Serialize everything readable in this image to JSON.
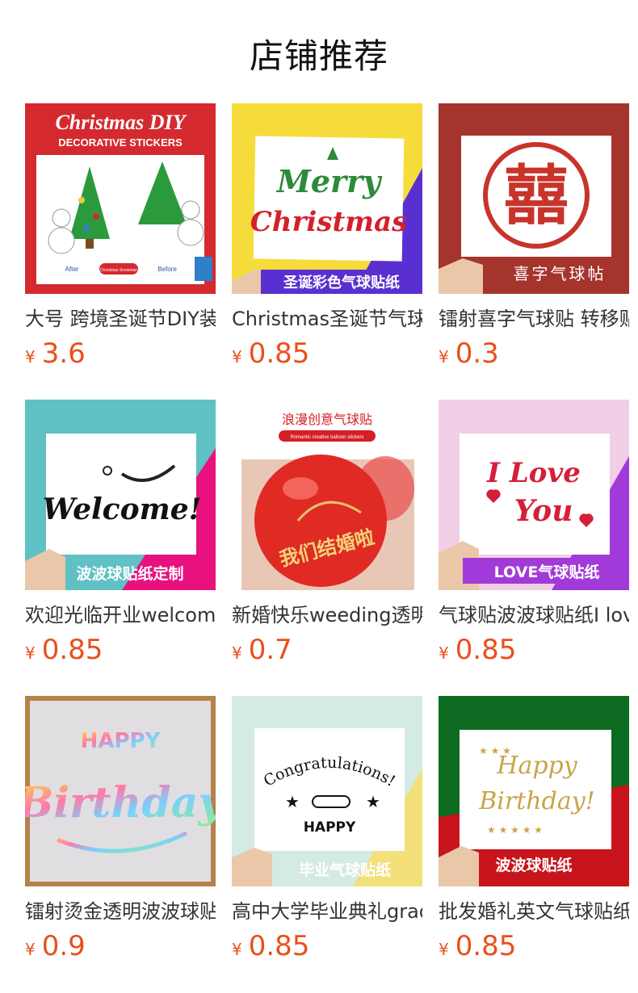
{
  "header": {
    "title": "店铺推荐"
  },
  "products": [
    {
      "name": "大号 跨境圣诞节DIY装饰贴纸",
      "currency": "¥",
      "price": "3.6",
      "image": {
        "banner": "Christmas DIY",
        "sub": "DECORATIVE STICKERS",
        "label_left": "After",
        "label_mid": "Christmas Snowman",
        "label_right": "Before",
        "bg": "#d42a2f"
      }
    },
    {
      "name": "Christmas圣诞节气球贴纸",
      "currency": "¥",
      "price": "0.85",
      "image": {
        "line1": "Merry",
        "line2": "Christmas",
        "caption": "圣诞彩色气球贴纸",
        "bg": "#f6dc3b",
        "accent": "#5a2fd1"
      }
    },
    {
      "name": "镭射喜字气球贴 转移贴",
      "currency": "¥",
      "price": "0.3",
      "image": {
        "symbol": "囍",
        "caption": "喜字气球帖",
        "bg": "#a4342c"
      }
    },
    {
      "name": "欢迎光临开业welcome气球贴",
      "currency": "¥",
      "price": "0.85",
      "image": {
        "word": "Welcome!",
        "caption": "波波球贴纸定制",
        "bg": "#5fc1c4",
        "accent": "#e8127e"
      }
    },
    {
      "name": "新婚快乐weeding透明气球贴",
      "currency": "¥",
      "price": "0.7",
      "image": {
        "heading": "浪漫创意气球贴",
        "sub": "Romantic creative balloon stickers",
        "balloon_text": "我们结婚啦"
      }
    },
    {
      "name": "气球贴波波球贴纸I love you",
      "currency": "¥",
      "price": "0.85",
      "image": {
        "line1": "I Love",
        "line2": "You",
        "caption": "LOVE气球贴纸",
        "bg": "#f1cfe6",
        "accent": "#a23ad9"
      }
    },
    {
      "name": "镭射烫金透明波波球贴纸",
      "currency": "¥",
      "price": "0.9",
      "image": {
        "line1": "HAPPY",
        "line2": "Birthday"
      }
    },
    {
      "name": "高中大学毕业典礼graduation",
      "currency": "¥",
      "price": "0.85",
      "image": {
        "arc": "Congratulations!",
        "word": "HAPPY",
        "caption": "毕业气球贴纸",
        "bg": "#d3ebe4",
        "accent": "#f4e07a"
      }
    },
    {
      "name": "批发婚礼英文气球贴纸",
      "currency": "¥",
      "price": "0.85",
      "image": {
        "line1": "Happy",
        "line2": "Birthday!",
        "caption": "波波球贴纸",
        "bg": "#0d6b22",
        "accent": "#c8141c"
      }
    }
  ]
}
